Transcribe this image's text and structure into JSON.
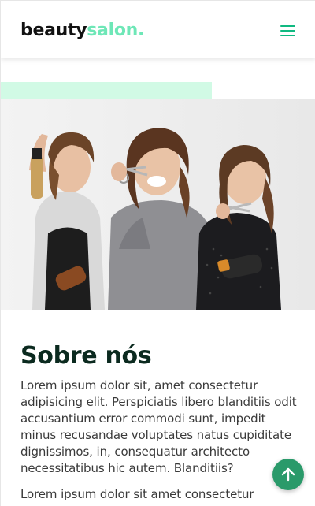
{
  "header": {
    "logo_primary": "beauty",
    "logo_accent": "salon.",
    "menu_icon": "hamburger-menu-icon"
  },
  "hero": {
    "image": "photo-three-smiling-hairstylists-holding-scissors-and-brushes"
  },
  "about": {
    "title": "Sobre nós",
    "paragraph_1": "Lorem ipsum dolor sit, amet consectetur adipisicing elit. Perspiciatis libero blanditiis odit accusantium error commodi sunt, impedit minus recusandae voluptates natus cupiditate dignissimos, in, consequatur architecto necessitatibus hic autem. Blanditiis?",
    "paragraph_2": "Lorem ipsum dolor sit amet consectetur"
  },
  "scroll_top": {
    "icon": "arrow-up-icon"
  },
  "colors": {
    "accent": "#6ee7b7",
    "accent_light": "#d1fae5",
    "menu": "#10b981",
    "button": "#2a9a6a",
    "heading": "#0b2a1f"
  }
}
